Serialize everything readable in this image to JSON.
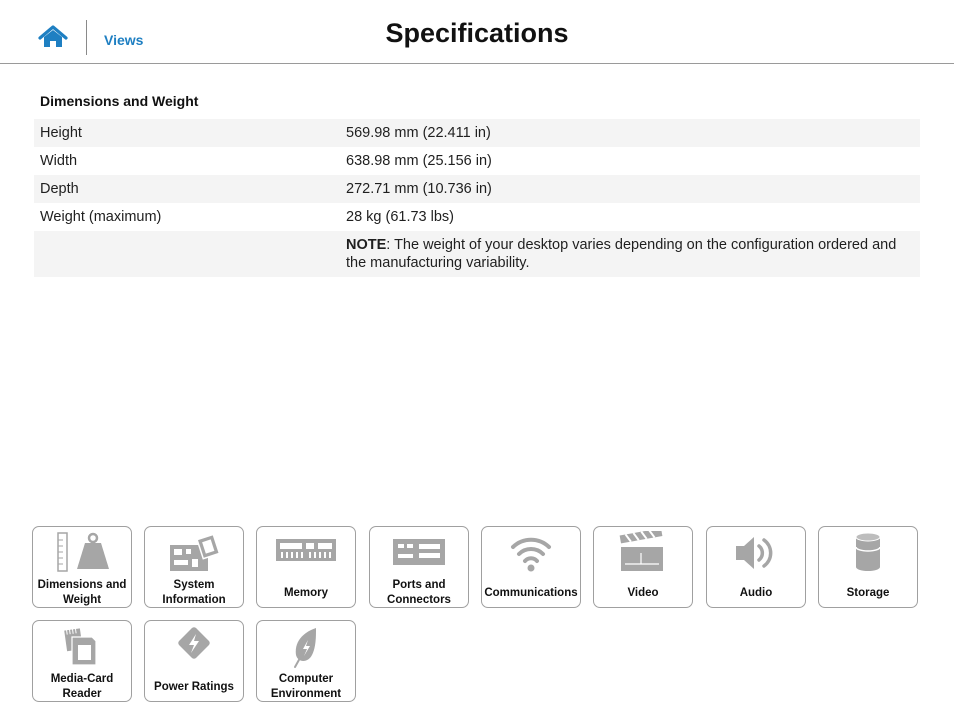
{
  "header": {
    "home_icon": "home-icon",
    "views_label": "Views",
    "title": "Specifications"
  },
  "section": {
    "title": "Dimensions and Weight",
    "rows": [
      {
        "label": "Height",
        "value": "569.98 mm (22.411 in)"
      },
      {
        "label": "Width",
        "value": "638.98 mm (25.156 in)"
      },
      {
        "label": "Depth",
        "value": "272.71 mm (10.736 in)"
      },
      {
        "label": "Weight (maximum)",
        "value": "28 kg (61.73 lbs)"
      }
    ],
    "note": {
      "bold": "NOTE",
      "text": ": The weight of your desktop varies depending on the configuration ordered and the manufacturing variability."
    }
  },
  "nav_tiles": [
    {
      "label": "Dimensions and Weight",
      "icon": "weight-icon"
    },
    {
      "label": "System Information",
      "icon": "motherboard-icon"
    },
    {
      "label": "Memory",
      "icon": "memory-icon"
    },
    {
      "label": "Ports and Connectors",
      "icon": "ports-icon"
    },
    {
      "label": "Communications",
      "icon": "wifi-icon"
    },
    {
      "label": "Video",
      "icon": "clapperboard-icon"
    },
    {
      "label": "Audio",
      "icon": "speaker-icon"
    },
    {
      "label": "Storage",
      "icon": "storage-icon"
    },
    {
      "label": "Media-Card Reader",
      "icon": "media-card-icon"
    },
    {
      "label": "Power Ratings",
      "icon": "power-icon"
    },
    {
      "label": "Computer Environment",
      "icon": "leaf-icon"
    }
  ],
  "colors": {
    "accent": "#1e7fc2",
    "icon_gray": "#a6a6a6",
    "row_shade": "#f4f4f4"
  }
}
